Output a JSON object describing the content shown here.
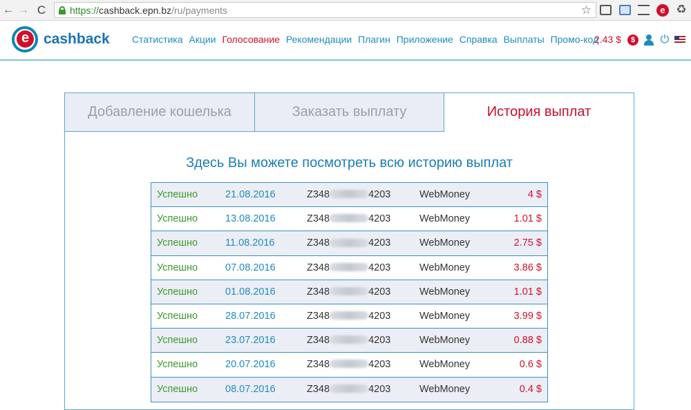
{
  "browser": {
    "url_scheme": "https://",
    "url_host": "cashback.epn.bz",
    "url_path": "/ru/payments",
    "back_glyph": "←",
    "forward_glyph": "→",
    "reload_glyph": "C",
    "star_glyph": "☆",
    "ext_e": "e",
    "ext_recycle": "♻"
  },
  "header": {
    "logo_mark": "e",
    "logo_text": "cashback",
    "menu": [
      {
        "label": "Статистика",
        "active": false
      },
      {
        "label": "Акции",
        "active": false
      },
      {
        "label": "Голосование",
        "active": true
      },
      {
        "label": "Рекомендации",
        "active": false
      },
      {
        "label": "Плагин",
        "active": false
      },
      {
        "label": "Приложение",
        "active": false
      },
      {
        "label": "Справка",
        "active": false
      },
      {
        "label": "Выплаты",
        "active": false
      },
      {
        "label": "Промо-код",
        "active": false
      }
    ],
    "balance": "2.43 $",
    "coin_glyph": "$",
    "power_glyph": "⏻"
  },
  "tabs": [
    {
      "label": "Добавление кошелька",
      "active": false
    },
    {
      "label": "Заказать выплату",
      "active": false
    },
    {
      "label": "История выплат",
      "active": true
    }
  ],
  "panel": {
    "title": "Здесь Вы можете посмотреть всю историю выплат"
  },
  "payments": [
    {
      "status": "Успешно",
      "date": "21.08.2016",
      "wallet_prefix": "Z348",
      "wallet_suffix": "4203",
      "system": "WebMoney",
      "amount": "4 $"
    },
    {
      "status": "Успешно",
      "date": "13.08.2016",
      "wallet_prefix": "Z348",
      "wallet_suffix": "4203",
      "system": "WebMoney",
      "amount": "1.01 $"
    },
    {
      "status": "Успешно",
      "date": "11.08.2016",
      "wallet_prefix": "Z348",
      "wallet_suffix": "4203",
      "system": "WebMoney",
      "amount": "2.75 $"
    },
    {
      "status": "Успешно",
      "date": "07.08.2016",
      "wallet_prefix": "Z348",
      "wallet_suffix": "4203",
      "system": "WebMoney",
      "amount": "3.86 $"
    },
    {
      "status": "Успешно",
      "date": "01.08.2016",
      "wallet_prefix": "Z348",
      "wallet_suffix": "4203",
      "system": "WebMoney",
      "amount": "1.01 $"
    },
    {
      "status": "Успешно",
      "date": "28.07.2016",
      "wallet_prefix": "Z348",
      "wallet_suffix": "4203",
      "system": "WebMoney",
      "amount": "3.99 $"
    },
    {
      "status": "Успешно",
      "date": "23.07.2016",
      "wallet_prefix": "Z348",
      "wallet_suffix": "4203",
      "system": "WebMoney",
      "amount": "0.88 $"
    },
    {
      "status": "Успешно",
      "date": "20.07.2016",
      "wallet_prefix": "Z348",
      "wallet_suffix": "4203",
      "system": "WebMoney",
      "amount": "0.6 $"
    },
    {
      "status": "Успешно",
      "date": "08.07.2016",
      "wallet_prefix": "Z348",
      "wallet_suffix": "4203",
      "system": "WebMoney",
      "amount": "0.4 $"
    }
  ],
  "colors": {
    "brand_blue": "#1d8cbf",
    "brand_red": "#d0102b",
    "success_green": "#3a9a2c"
  }
}
